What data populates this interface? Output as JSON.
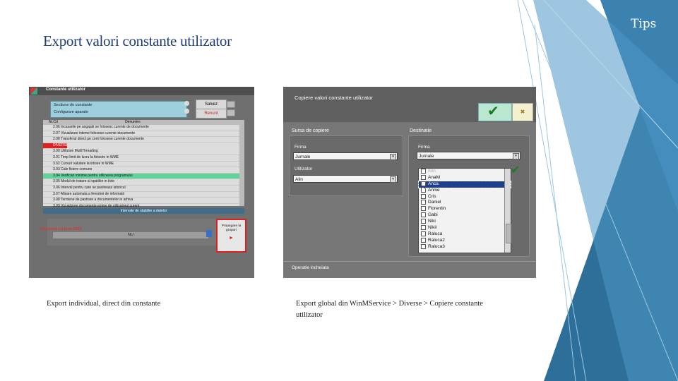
{
  "slide": {
    "title": "Export valori constante utilizator",
    "tips": "Tips",
    "caption_left": "Export individual, direct din constante",
    "caption_right": "Export global din WinMService > Diverse > Copiere constante utilizator"
  },
  "left_screenshot": {
    "window_title": "Constante utilizator",
    "selector_items": [
      "Sectiune de constante",
      "Configurare aparate"
    ],
    "buttons": {
      "save": "Salvez",
      "exit": "Renunt"
    },
    "columns": [
      "Nr.Crt",
      "Denumire"
    ],
    "rows": [
      "2.06 Incasarile pe angajati se folosesc curente de documente",
      "2.07 Vizualizare inteme folosese curente documente",
      "2.08 Transferul direct pe cont folosese curente documente",
      "DIVERSE",
      "3.00 Utilizare MultiThreading",
      "3.01 Timp limit de lucru la folosire in WME",
      "3.02 Cursuri valutare la intrare in WME",
      "3.03 Cale fisiere comune",
      "3.04 Verificari minime pentru utilizarea programului",
      "3.05 Modul de tratare al spatiilor in liste",
      "3.06 Interval pentru care se pastreaza istoricul",
      "3.07 Afisare automata a ferestrei de informatii",
      "3.08 Termene de pastrare a documentelor in arhiva",
      "3.09 Vizualizare documente emise de utilizatorul curent"
    ],
    "section_strip": "Intervale de stabilire a datelor",
    "red_label": "Incepand cu luna 2013",
    "value_field": "NU",
    "propagate_button": "Propagare la grupuri"
  },
  "right_screenshot": {
    "window_title": "Copiere valori constante utilizator",
    "source_label": "Sursa de copiere",
    "destination_label": "Destinatie",
    "firma_label": "Firma",
    "firma_value": "Jurnale",
    "utilizator_label": "Utilizator",
    "utilizator_value": "Alin",
    "dest_firma_label": "Firma",
    "dest_firma_value": "Jurnale",
    "users": [
      "Alin",
      "AnaM",
      "Anca",
      "Annie",
      "Cris",
      "Daniel",
      "Florentin",
      "Gabi",
      "Niki",
      "Nikil",
      "Raluca",
      "Raluca2",
      "Raluca3"
    ],
    "selected_user": "Anca",
    "footer": "Operatie incheiata",
    "colors": {
      "accent_green": "#1a7a2a",
      "selection": "#1e3f8a"
    }
  }
}
